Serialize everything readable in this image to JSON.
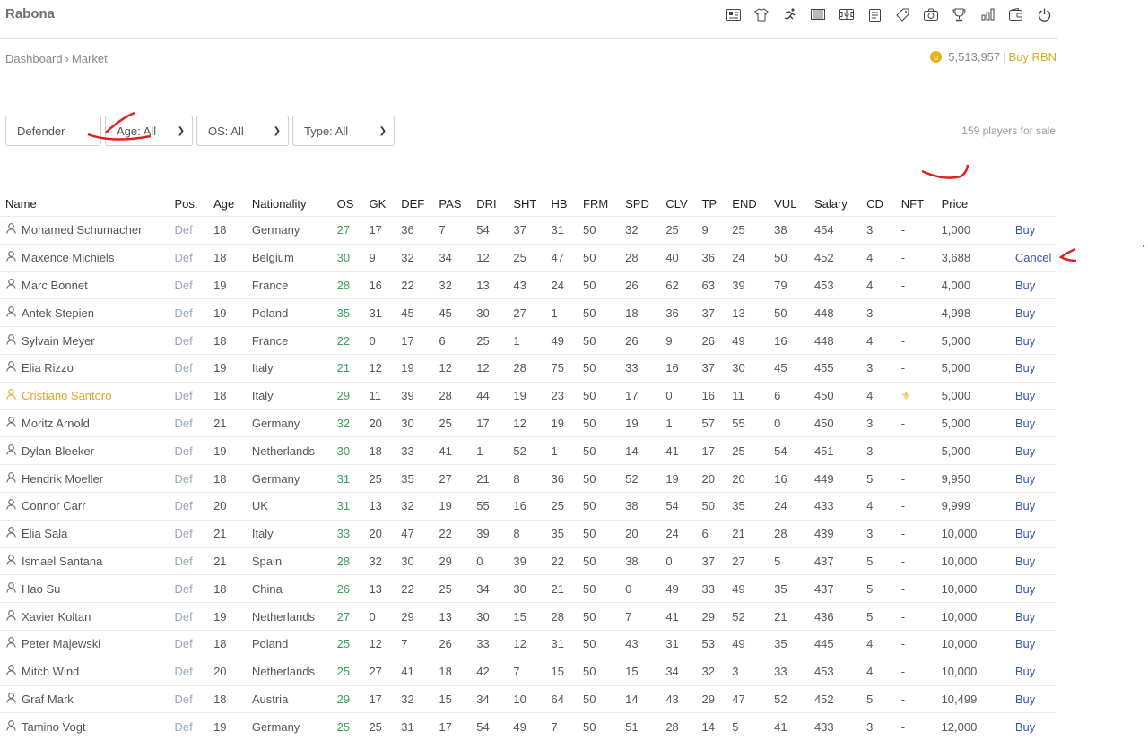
{
  "header": {
    "brand": "Rabona",
    "nav_icons": [
      "id-card-icon",
      "shirt-icon",
      "runner-icon",
      "stadium-icon",
      "field-icon",
      "clipboard-icon",
      "tag-icon",
      "dashboard-icon",
      "trophy-icon",
      "bar-chart-icon",
      "wallet-icon",
      "power-icon"
    ]
  },
  "breadcrumb": {
    "parent": "Dashboard",
    "current": "Market"
  },
  "wallet": {
    "balance": "5,513,957",
    "separator": "|",
    "buy_label": "Buy RBN",
    "coin": "c"
  },
  "filters": {
    "position": "Defender",
    "age": "Age: All",
    "os": "OS: All",
    "type": "Type: All"
  },
  "players_count": "159 players for sale",
  "table": {
    "headers": [
      "Name",
      "Pos.",
      "Age",
      "Nationality",
      "OS",
      "GK",
      "DEF",
      "PAS",
      "DRI",
      "SHT",
      "HB",
      "FRM",
      "SPD",
      "CLV",
      "TP",
      "END",
      "VUL",
      "Salary",
      "CD",
      "NFT",
      "Price",
      ""
    ],
    "rows": [
      {
        "name": "Mohamed Schumacher",
        "pos": "Def",
        "age": "18",
        "nat": "Germany",
        "os": "27",
        "gk": "17",
        "def": "36",
        "pas": "7",
        "dri": "54",
        "sht": "37",
        "hb": "31",
        "frm": "50",
        "spd": "32",
        "clv": "25",
        "tp": "9",
        "end": "25",
        "vul": "38",
        "salary": "454",
        "cd": "3",
        "nft": "-",
        "price": "1,000",
        "action": "Buy"
      },
      {
        "name": "Maxence Michiels",
        "pos": "Def",
        "age": "18",
        "nat": "Belgium",
        "os": "30",
        "gk": "9",
        "def": "32",
        "pas": "34",
        "dri": "12",
        "sht": "25",
        "hb": "47",
        "frm": "50",
        "spd": "28",
        "clv": "40",
        "tp": "36",
        "end": "24",
        "vul": "50",
        "salary": "452",
        "cd": "4",
        "nft": "-",
        "price": "3,688",
        "action": "Cancel"
      },
      {
        "name": "Marc Bonnet",
        "pos": "Def",
        "age": "19",
        "nat": "France",
        "os": "28",
        "gk": "16",
        "def": "22",
        "pas": "32",
        "dri": "13",
        "sht": "43",
        "hb": "24",
        "frm": "50",
        "spd": "26",
        "clv": "62",
        "tp": "63",
        "end": "39",
        "vul": "79",
        "salary": "453",
        "cd": "4",
        "nft": "-",
        "price": "4,000",
        "action": "Buy"
      },
      {
        "name": "Antek Stepien",
        "pos": "Def",
        "age": "19",
        "nat": "Poland",
        "os": "35",
        "gk": "31",
        "def": "45",
        "pas": "45",
        "dri": "30",
        "sht": "27",
        "hb": "1",
        "frm": "50",
        "spd": "18",
        "clv": "36",
        "tp": "37",
        "end": "13",
        "vul": "50",
        "salary": "448",
        "cd": "3",
        "nft": "-",
        "price": "4,998",
        "action": "Buy"
      },
      {
        "name": "Sylvain Meyer",
        "pos": "Def",
        "age": "18",
        "nat": "France",
        "os": "22",
        "gk": "0",
        "def": "17",
        "pas": "6",
        "dri": "25",
        "sht": "1",
        "hb": "49",
        "frm": "50",
        "spd": "26",
        "clv": "9",
        "tp": "26",
        "end": "49",
        "vul": "16",
        "salary": "448",
        "cd": "4",
        "nft": "-",
        "price": "5,000",
        "action": "Buy"
      },
      {
        "name": "Elia Rizzo",
        "pos": "Def",
        "age": "19",
        "nat": "Italy",
        "os": "21",
        "gk": "12",
        "def": "19",
        "pas": "12",
        "dri": "12",
        "sht": "28",
        "hb": "75",
        "frm": "50",
        "spd": "33",
        "clv": "16",
        "tp": "37",
        "end": "30",
        "vul": "45",
        "salary": "455",
        "cd": "3",
        "nft": "-",
        "price": "5,000",
        "action": "Buy"
      },
      {
        "name": "Cristiano Santoro",
        "pos": "Def",
        "age": "18",
        "nat": "Italy",
        "os": "29",
        "gk": "11",
        "def": "39",
        "pas": "28",
        "dri": "44",
        "sht": "19",
        "hb": "23",
        "frm": "50",
        "spd": "17",
        "clv": "0",
        "tp": "16",
        "end": "11",
        "vul": "6",
        "salary": "450",
        "cd": "4",
        "nft": "⚜",
        "price": "5,000",
        "action": "Buy",
        "highlight": true
      },
      {
        "name": "Moritz Arnold",
        "pos": "Def",
        "age": "21",
        "nat": "Germany",
        "os": "32",
        "gk": "20",
        "def": "30",
        "pas": "25",
        "dri": "17",
        "sht": "12",
        "hb": "19",
        "frm": "50",
        "spd": "19",
        "clv": "1",
        "tp": "57",
        "end": "55",
        "vul": "0",
        "salary": "450",
        "cd": "3",
        "nft": "-",
        "price": "5,000",
        "action": "Buy"
      },
      {
        "name": "Dylan Bleeker",
        "pos": "Def",
        "age": "19",
        "nat": "Netherlands",
        "os": "30",
        "gk": "18",
        "def": "33",
        "pas": "41",
        "dri": "1",
        "sht": "52",
        "hb": "1",
        "frm": "50",
        "spd": "14",
        "clv": "41",
        "tp": "17",
        "end": "25",
        "vul": "54",
        "salary": "451",
        "cd": "3",
        "nft": "-",
        "price": "5,000",
        "action": "Buy"
      },
      {
        "name": "Hendrik Moeller",
        "pos": "Def",
        "age": "18",
        "nat": "Germany",
        "os": "31",
        "gk": "25",
        "def": "35",
        "pas": "27",
        "dri": "21",
        "sht": "8",
        "hb": "36",
        "frm": "50",
        "spd": "52",
        "clv": "19",
        "tp": "20",
        "end": "20",
        "vul": "16",
        "salary": "449",
        "cd": "5",
        "nft": "-",
        "price": "9,950",
        "action": "Buy"
      },
      {
        "name": "Connor Carr",
        "pos": "Def",
        "age": "20",
        "nat": "UK",
        "os": "31",
        "gk": "13",
        "def": "32",
        "pas": "19",
        "dri": "55",
        "sht": "16",
        "hb": "25",
        "frm": "50",
        "spd": "38",
        "clv": "54",
        "tp": "50",
        "end": "35",
        "vul": "24",
        "salary": "433",
        "cd": "4",
        "nft": "-",
        "price": "9,999",
        "action": "Buy"
      },
      {
        "name": "Elia Sala",
        "pos": "Def",
        "age": "21",
        "nat": "Italy",
        "os": "33",
        "gk": "20",
        "def": "47",
        "pas": "22",
        "dri": "39",
        "sht": "8",
        "hb": "35",
        "frm": "50",
        "spd": "20",
        "clv": "24",
        "tp": "6",
        "end": "21",
        "vul": "28",
        "salary": "439",
        "cd": "3",
        "nft": "-",
        "price": "10,000",
        "action": "Buy"
      },
      {
        "name": "Ismael Santana",
        "pos": "Def",
        "age": "21",
        "nat": "Spain",
        "os": "28",
        "gk": "32",
        "def": "30",
        "pas": "29",
        "dri": "0",
        "sht": "39",
        "hb": "22",
        "frm": "50",
        "spd": "38",
        "clv": "0",
        "tp": "37",
        "end": "27",
        "vul": "5",
        "salary": "437",
        "cd": "5",
        "nft": "-",
        "price": "10,000",
        "action": "Buy"
      },
      {
        "name": "Hao Su",
        "pos": "Def",
        "age": "18",
        "nat": "China",
        "os": "26",
        "gk": "13",
        "def": "22",
        "pas": "25",
        "dri": "34",
        "sht": "30",
        "hb": "21",
        "frm": "50",
        "spd": "0",
        "clv": "49",
        "tp": "33",
        "end": "49",
        "vul": "35",
        "salary": "437",
        "cd": "5",
        "nft": "-",
        "price": "10,000",
        "action": "Buy"
      },
      {
        "name": "Xavier Koltan",
        "pos": "Def",
        "age": "19",
        "nat": "Netherlands",
        "os": "27",
        "gk": "0",
        "def": "29",
        "pas": "13",
        "dri": "30",
        "sht": "15",
        "hb": "28",
        "frm": "50",
        "spd": "7",
        "clv": "41",
        "tp": "29",
        "end": "52",
        "vul": "21",
        "salary": "436",
        "cd": "5",
        "nft": "-",
        "price": "10,000",
        "action": "Buy"
      },
      {
        "name": "Peter Majewski",
        "pos": "Def",
        "age": "18",
        "nat": "Poland",
        "os": "25",
        "gk": "12",
        "def": "7",
        "pas": "26",
        "dri": "33",
        "sht": "12",
        "hb": "31",
        "frm": "50",
        "spd": "43",
        "clv": "31",
        "tp": "53",
        "end": "49",
        "vul": "35",
        "salary": "445",
        "cd": "4",
        "nft": "-",
        "price": "10,000",
        "action": "Buy"
      },
      {
        "name": "Mitch Wind",
        "pos": "Def",
        "age": "20",
        "nat": "Netherlands",
        "os": "25",
        "gk": "27",
        "def": "41",
        "pas": "18",
        "dri": "42",
        "sht": "7",
        "hb": "15",
        "frm": "50",
        "spd": "15",
        "clv": "34",
        "tp": "32",
        "end": "3",
        "vul": "33",
        "salary": "453",
        "cd": "4",
        "nft": "-",
        "price": "10,000",
        "action": "Buy"
      },
      {
        "name": "Graf Mark",
        "pos": "Def",
        "age": "18",
        "nat": "Austria",
        "os": "29",
        "gk": "17",
        "def": "32",
        "pas": "15",
        "dri": "34",
        "sht": "10",
        "hb": "64",
        "frm": "50",
        "spd": "14",
        "clv": "43",
        "tp": "29",
        "end": "47",
        "vul": "52",
        "salary": "452",
        "cd": "5",
        "nft": "-",
        "price": "10,499",
        "action": "Buy"
      },
      {
        "name": "Tamino Vogt",
        "pos": "Def",
        "age": "19",
        "nat": "Germany",
        "os": "25",
        "gk": "25",
        "def": "31",
        "pas": "17",
        "dri": "54",
        "sht": "49",
        "hb": "7",
        "frm": "50",
        "spd": "51",
        "clv": "28",
        "tp": "14",
        "end": "5",
        "vul": "41",
        "salary": "433",
        "cd": "3",
        "nft": "-",
        "price": "12,000",
        "action": "Buy"
      }
    ]
  },
  "colors": {
    "accent_gold": "#d9a72a",
    "link_blue": "#3b56b3",
    "os_green": "#3aa05a",
    "pos_gray": "#9aa6b8",
    "annotation_red": "#e02020"
  }
}
